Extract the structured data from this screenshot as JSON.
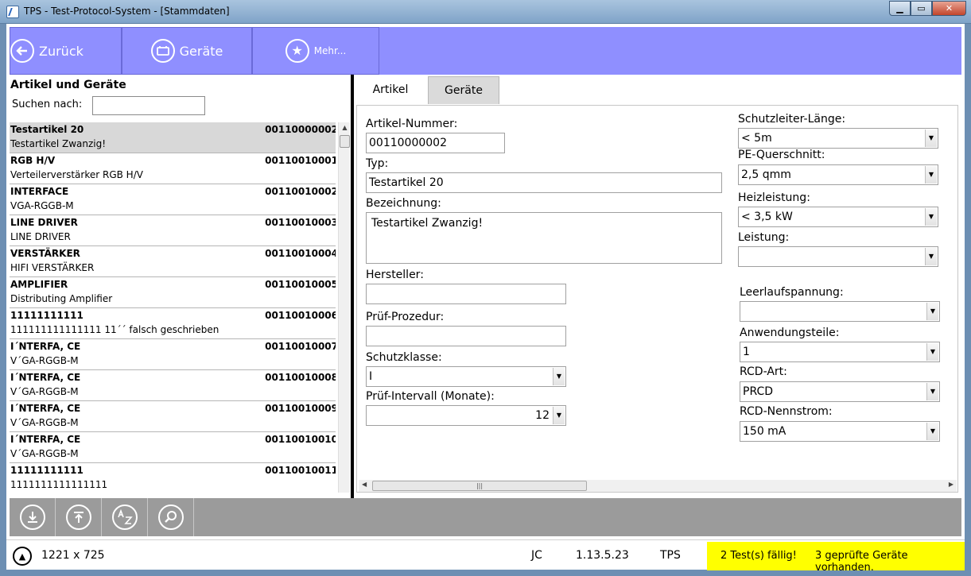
{
  "window": {
    "title": "TPS - Test-Protocol-System - [Stammdaten]"
  },
  "toolbar": {
    "back_label": "Zurück",
    "devices_label": "Geräte",
    "more_label": "Mehr..."
  },
  "left": {
    "title": "Artikel und Geräte",
    "search_label": "Suchen  nach:",
    "search_value": "",
    "items": [
      {
        "name": "Testartikel 20",
        "number": "00110000002",
        "desc": "Testartikel Zwanzig!"
      },
      {
        "name": "RGB H/V",
        "number": "00110010001",
        "desc": "Verteilerverstärker RGB H/V"
      },
      {
        "name": "INTERFACE",
        "number": "00110010002",
        "desc": "VGA-RGGB-M"
      },
      {
        "name": "LINE DRIVER",
        "number": "00110010003",
        "desc": "LINE DRIVER"
      },
      {
        "name": "VERSTÄRKER",
        "number": "00110010004",
        "desc": "HIFI VERSTÄRKER"
      },
      {
        "name": "AMPLIFIER",
        "number": "00110010005",
        "desc": "Distributing Amplifier"
      },
      {
        "name": "11111111111",
        "number": "00110010006",
        "desc": "111111111111111 11´´ falsch geschrieben"
      },
      {
        "name": "I´NTERFA, CE",
        "number": "00110010007",
        "desc": "V´GA-RGGB-M"
      },
      {
        "name": "I´NTERFA, CE",
        "number": "00110010008",
        "desc": "V´GA-RGGB-M"
      },
      {
        "name": "I´NTERFA, CE",
        "number": "00110010009",
        "desc": "V´GA-RGGB-M"
      },
      {
        "name": "I´NTERFA, CE",
        "number": "00110010010",
        "desc": "V´GA-RGGB-M"
      },
      {
        "name": "11111111111",
        "number": "00110010011",
        "desc": "1111111111111111"
      }
    ]
  },
  "tabs": {
    "article": "Artikel",
    "devices": "Geräte"
  },
  "form": {
    "artikel_nummer_label": "Artikel-Nummer:",
    "artikel_nummer": "00110000002",
    "typ_label": "Typ:",
    "typ": "Testartikel 20",
    "bezeichnung_label": "Bezeichnung:",
    "bezeichnung": "Testartikel Zwanzig!",
    "hersteller_label": "Hersteller:",
    "hersteller": "",
    "pruef_prozedur_label": "Prüf-Prozedur:",
    "pruef_prozedur": "",
    "schutzklasse_label": "Schutzklasse:",
    "schutzklasse": "I",
    "pruef_intervall_label": "Prüf-Intervall (Monate):",
    "pruef_intervall": "12",
    "schutzleiter_laenge_label": "Schutzleiter-Länge:",
    "schutzleiter_laenge": "< 5m",
    "pe_querschnitt_label": "PE-Querschnitt:",
    "pe_querschnitt": "2,5 qmm",
    "heizleistung_label": "Heizleistung:",
    "heizleistung": "< 3,5 kW",
    "leistung_label": "Leistung:",
    "leistung": "",
    "leerlaufspannung_label": "Leerlaufspannung:",
    "leerlaufspannung": "",
    "anwendungsteile_label": "Anwendungsteile:",
    "anwendungsteile": "1",
    "rcd_art_label": "RCD-Art:",
    "rcd_art": "PRCD",
    "rcd_nennstrom_label": "RCD-Nennstrom:",
    "rcd_nennstrom": "150 mA"
  },
  "status": {
    "resolution": "1221 x 725",
    "user": "JC",
    "version": "1.13.5.23",
    "app": "TPS",
    "tests_due": "2 Test(s) fällig!",
    "checked_devices": "3 geprüfte Geräte vorhanden.",
    "warn_color": "#ffff00"
  },
  "colors": {
    "toolbar": "#8f8fff",
    "actionbar": "#9b9b9b"
  }
}
